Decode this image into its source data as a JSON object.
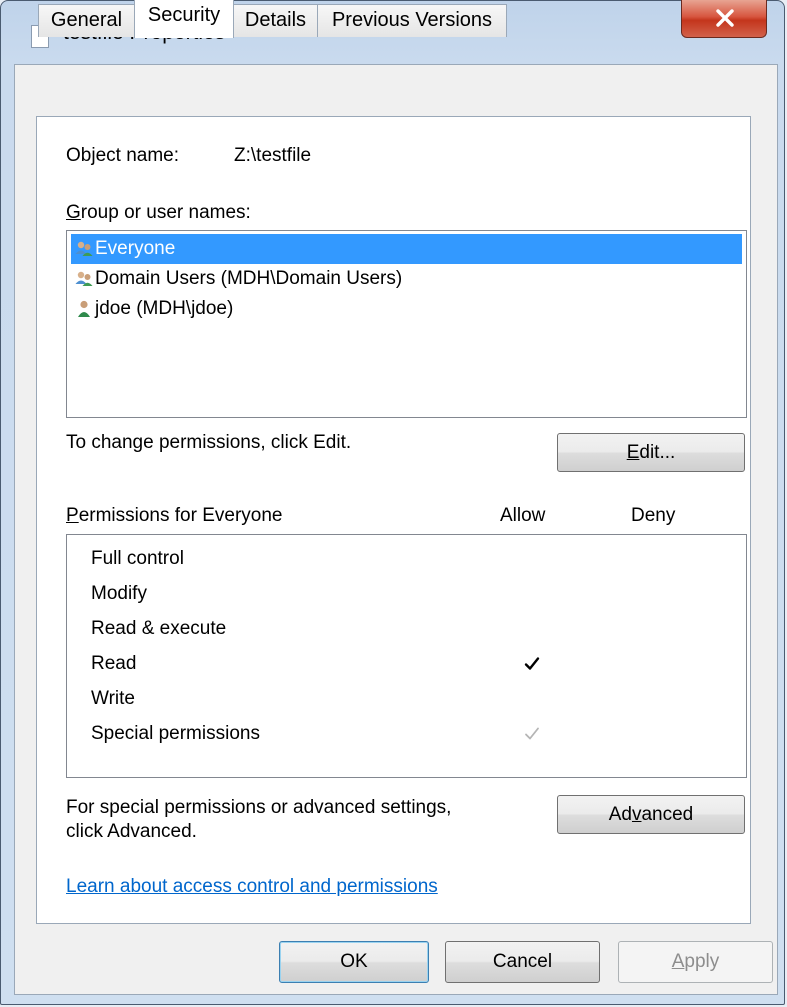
{
  "window": {
    "title": "testfile Properties",
    "close_symbol": "X"
  },
  "tabs": [
    "General",
    "Security",
    "Details",
    "Previous Versions"
  ],
  "active_tab": "Security",
  "object": {
    "label": "Object name:",
    "value": "Z:\\testfile"
  },
  "groups": {
    "label_accel": "G",
    "label_rest": "roup or user names:",
    "items": [
      {
        "name": "Everyone",
        "icon": "users-group-icon",
        "selected": true
      },
      {
        "name": "Domain Users (MDH\\Domain Users)",
        "icon": "users-group-icon",
        "selected": false
      },
      {
        "name": "jdoe (MDH\\jdoe)",
        "icon": "user-icon",
        "selected": false
      }
    ]
  },
  "change_hint": "To change permissions, click Edit.",
  "edit_button": {
    "accel": "E",
    "rest": "dit..."
  },
  "permissions": {
    "label_accel": "P",
    "label_rest": "ermissions for Everyone",
    "allow_header": "Allow",
    "deny_header": "Deny",
    "rows": [
      {
        "name": "Full control",
        "allow": "",
        "deny": ""
      },
      {
        "name": "Modify",
        "allow": "",
        "deny": ""
      },
      {
        "name": "Read & execute",
        "allow": "",
        "deny": ""
      },
      {
        "name": "Read",
        "allow": "checked",
        "deny": ""
      },
      {
        "name": "Write",
        "allow": "",
        "deny": ""
      },
      {
        "name": "Special permissions",
        "allow": "checked-gray",
        "deny": ""
      }
    ]
  },
  "advanced_hint": {
    "line1": "For special permissions or advanced settings,",
    "line2": "click Advanced."
  },
  "advanced_button": {
    "before": "Ad",
    "accel": "v",
    "after": "anced"
  },
  "link": "Learn about access control and permissions",
  "footer": {
    "ok": "OK",
    "cancel": "Cancel",
    "apply_accel": "A",
    "apply_rest": "pply"
  },
  "colors": {
    "selection": "#3399ff",
    "link": "#0066cc",
    "close_button": "#c4351c"
  }
}
